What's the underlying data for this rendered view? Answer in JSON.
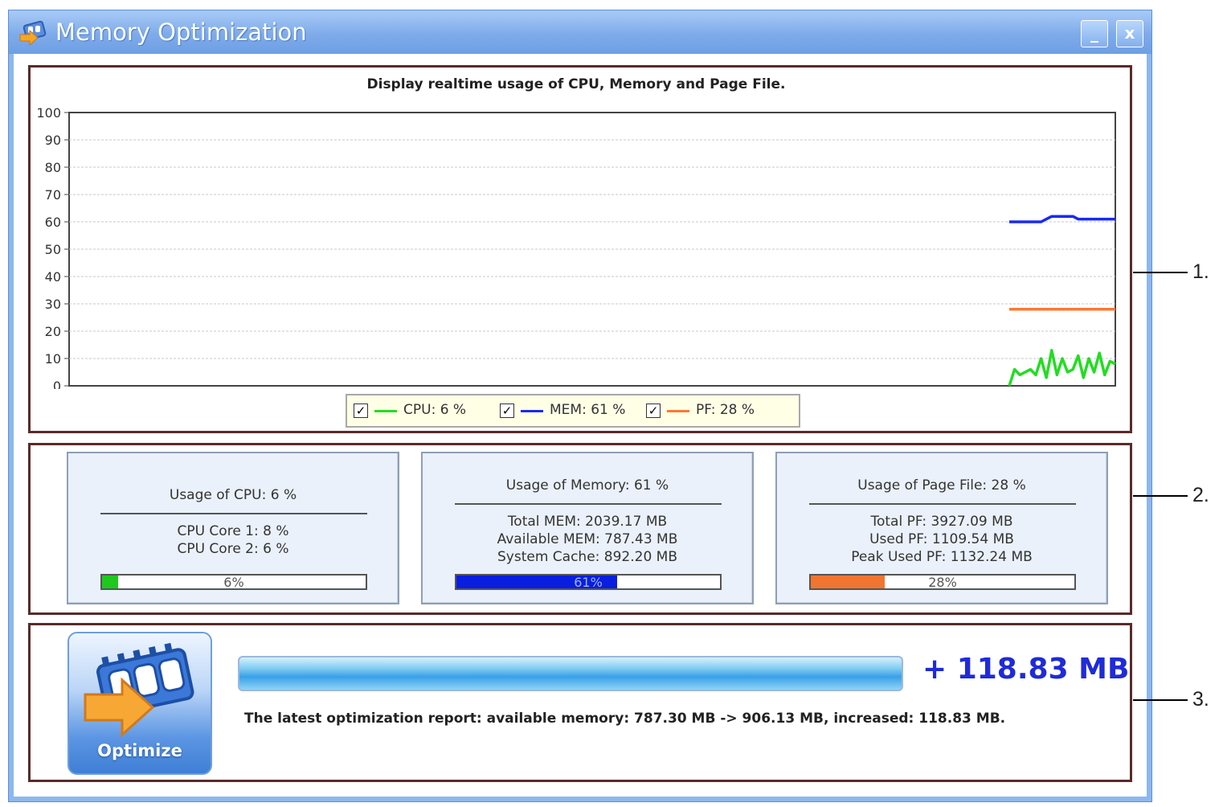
{
  "window": {
    "title": "Memory Optimization",
    "minimize_label": "_",
    "close_label": "x"
  },
  "chart": {
    "title": "Display realtime usage of CPU, Memory and Page File.",
    "legend": [
      {
        "label": "CPU: 6 %",
        "color": "#22dd22",
        "checked": true
      },
      {
        "label": "MEM: 61 %",
        "color": "#1a2aee",
        "checked": true
      },
      {
        "label": "PF: 28 %",
        "color": "#ff7733",
        "checked": true
      }
    ]
  },
  "chart_data": {
    "type": "line",
    "title": "Display realtime usage of CPU, Memory and Page File.",
    "ylim": [
      0,
      100
    ],
    "yticks": [
      0,
      10,
      20,
      30,
      40,
      50,
      60,
      70,
      80,
      90,
      100
    ],
    "grid": true,
    "legend_position": "bottom-center",
    "x": [
      1,
      2,
      3,
      4,
      5,
      6,
      7,
      8,
      9,
      10,
      11,
      12,
      13,
      14,
      15,
      16,
      17,
      18,
      19,
      20,
      21
    ],
    "series": [
      {
        "name": "CPU: 6 %",
        "color": "#22dd22",
        "values": [
          0,
          6,
          4,
          5,
          6,
          4,
          10,
          3,
          13,
          4,
          10,
          5,
          6,
          11,
          3,
          10,
          5,
          12,
          4,
          9,
          8
        ]
      },
      {
        "name": "MEM: 61 %",
        "color": "#1a2aee",
        "values": [
          60,
          60,
          60,
          60,
          60,
          60,
          60,
          61,
          62,
          62,
          62,
          62,
          62,
          61,
          61,
          61,
          61,
          61,
          61,
          61,
          61
        ]
      },
      {
        "name": "PF: 28 %",
        "color": "#ff7733",
        "values": [
          28,
          28,
          28,
          28,
          28,
          28,
          28,
          28,
          28,
          28,
          28,
          28,
          28,
          28,
          28,
          28,
          28,
          28,
          28,
          28,
          28
        ]
      }
    ]
  },
  "stats": {
    "cpu": {
      "title": "Usage of CPU: 6 %",
      "lines": [
        "CPU Core 1: 8 %",
        "CPU Core 2: 6 %"
      ],
      "bar_label": "6%",
      "bar_fraction": 0.06,
      "bar_color": "#1ec81e"
    },
    "memory": {
      "title": "Usage of Memory: 61 %",
      "lines": [
        "Total MEM: 2039.17 MB",
        "Available MEM: 787.43 MB",
        "System Cache: 892.20 MB"
      ],
      "bar_label": "61%",
      "bar_fraction": 0.61,
      "bar_color": "#0a1ee0"
    },
    "pagefile": {
      "title": "Usage of Page File: 28 %",
      "lines": [
        "Total PF: 3927.09 MB",
        "Used PF: 1109.54 MB",
        "Peak Used PF: 1132.24 MB"
      ],
      "bar_label": "28%",
      "bar_fraction": 0.28,
      "bar_color": "#f07530"
    }
  },
  "optimize": {
    "button_label": "Optimize",
    "gain_value": "+ 118.83 MB",
    "report": "The latest optimization report: available memory: 787.30 MB -> 906.13 MB, increased: 118.83 MB."
  },
  "callouts": [
    "1.",
    "2.",
    "3."
  ]
}
